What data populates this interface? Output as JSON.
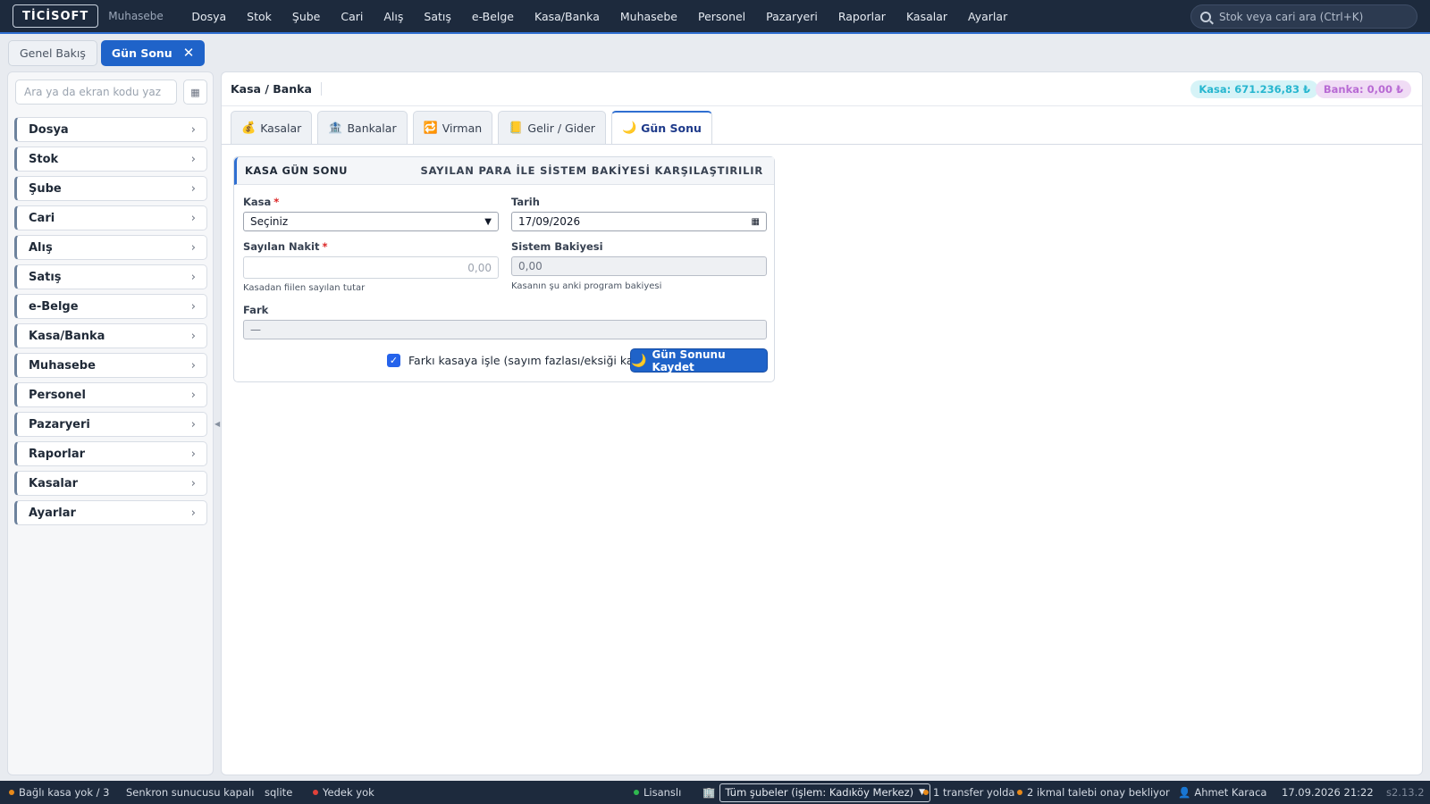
{
  "topbar": {
    "logo": "TİCİSOFT",
    "module": "Muhasebe",
    "menu": [
      "Dosya",
      "Stok",
      "Şube",
      "Cari",
      "Alış",
      "Satış",
      "e-Belge",
      "Kasa/Banka",
      "Muhasebe",
      "Personel",
      "Pazaryeri",
      "Raporlar",
      "Kasalar",
      "Ayarlar"
    ],
    "search_placeholder": "Stok veya cari ara (Ctrl+K)"
  },
  "page_tabs": [
    {
      "label": "Genel Bakış",
      "active": false
    },
    {
      "label": "Gün Sonu",
      "active": true,
      "close": "✕"
    }
  ],
  "sidebar": {
    "search_placeholder": "Ara ya da ekran kodu yaz",
    "items": [
      "Dosya",
      "Stok",
      "Şube",
      "Cari",
      "Alış",
      "Satış",
      "e-Belge",
      "Kasa/Banka",
      "Muhasebe",
      "Personel",
      "Pazaryeri",
      "Raporlar",
      "Kasalar",
      "Ayarlar"
    ]
  },
  "main": {
    "title": "Kasa / Banka",
    "kasa_balance": "Kasa: 671.236,83 ₺",
    "banka_balance": "Banka: 0,00 ₺",
    "subtabs": [
      {
        "label": "Kasalar",
        "icon": "money-bag-icon",
        "glyph": "💰"
      },
      {
        "label": "Bankalar",
        "icon": "bank-icon",
        "glyph": "🏦"
      },
      {
        "label": "Virman",
        "icon": "transfer-icon",
        "glyph": "🔁"
      },
      {
        "label": "Gelir / Gider",
        "icon": "ledger-icon",
        "glyph": "📒"
      },
      {
        "label": "Gün Sonu",
        "icon": "moon-icon",
        "glyph": "🌙",
        "active": true
      }
    ]
  },
  "form": {
    "title": "KASA GÜN SONU",
    "subtitle": "SAYILAN PARA İLE SİSTEM BAKİYESİ KARŞILAŞTIRILIR",
    "kasa_label": "Kasa",
    "kasa_value": "Seçiniz",
    "tarih_label": "Tarih",
    "tarih_value": "17/09/2026",
    "sayilan_label": "Sayılan Nakit",
    "sayilan_placeholder": "0,00",
    "sayilan_help": "Kasadan fiilen sayılan tutar",
    "sistem_label": "Sistem Bakiyesi",
    "sistem_value": "0,00",
    "sistem_help": "Kasanın şu anki program bakiyesi",
    "fark_label": "Fark",
    "fark_value": "—",
    "required_mark": "*",
    "checkbox_label": "Farkı kasaya işle (sayım fazlası/eksiği kaydı)",
    "checkbox_checked": true,
    "save_label": "Gün Sonunu Kaydet"
  },
  "statusbar": {
    "kasa": "Bağlı kasa yok / 3",
    "sync": "Senkron sunucusu kapalı",
    "db": "sqlite",
    "backup": "Yedek yok",
    "license": "Lisanslı",
    "branch": "Tüm şubeler (işlem: Kadıköy Merkez)",
    "transfer": "1 transfer yolda",
    "ikmal": "2 ikmal talebi onay bekliyor",
    "user": "Ahmet Karaca",
    "datetime": "17.09.2026 21:22",
    "version": "s2.13.2"
  },
  "colors": {
    "accent": "#1f63c9",
    "topbar": "#1d2a3d",
    "kasa_pill": "#26b6cf",
    "banka_pill": "#b86ad4",
    "status_orange": "#e88a1a",
    "status_red": "#e0413a",
    "status_green": "#2fb84f"
  }
}
